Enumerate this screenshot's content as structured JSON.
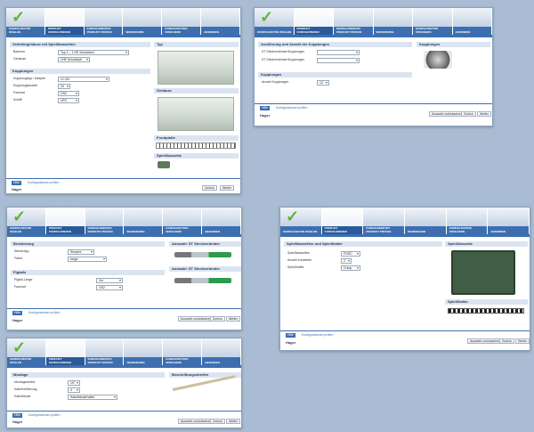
{
  "tabs": [
    {
      "label": "KONFIGURATOR WÄHLEN"
    },
    {
      "label": "PRODUKT KONFIGURIEREN"
    },
    {
      "label": "KONFIGURIERTES PRODUKT PRÜFEN"
    },
    {
      "label": "WARENKORB"
    },
    {
      "label": "KONFIGURATION SPEICHERN"
    },
    {
      "label": "ABSENDEN"
    }
  ],
  "shot1": {
    "section_main": "Verteilergehäuse mit Spleißkassetten",
    "row_bauform": "Bauform",
    "sel_bauform": "Typ 1 – 1 HE Schubfach",
    "row_gehaeuse": "Gehäuse",
    "sel_gehaeuse": "1HE Schubfach",
    "section_kupplungen": "Kupplungen",
    "row_kupplungstyp": "Kupplungstyp / Adapter",
    "sel_kupplungstyp": "LC-DX",
    "row_kupplungsanzahl": "Kupplungsanzahl",
    "sel_kupplungsanzahl": "24",
    "row_faserart1": "Faserart",
    "sel_faserart1": "OS2",
    "row_faserart2": "Schliff",
    "sel_faserart2": "UPC",
    "right_top": "Typ",
    "right_mid": "Gehäuse",
    "right_frontplatte": "Frontplatte",
    "right_spleiss": "Spleißkassette",
    "help": "Hilfe",
    "link": "Konfigurationen prüfen",
    "btn_back": "Zurück",
    "btn_next": "Weiter",
    "logo": "Hager"
  },
  "shot2": {
    "section_main": "Ausführung und Anzahl der Kupplungen",
    "row1": "ST Steckverbinder/Kupplungen",
    "row2": "ST Steckverbinder/Kupplungen",
    "section_kupplungen": "Kupplungen",
    "row3": "Anzahl Kupplungen",
    "sel3": "12",
    "right_title": "Kupplungen",
    "help": "Hilfe",
    "link": "Konfigurationen prüfen",
    "btn_reset": "Auswahl zurücksetzen",
    "btn_back": "Zurück",
    "btn_next": "Weiter",
    "logo": "Hager"
  },
  "shot3": {
    "section_main": "Bestückung",
    "row1": "Steckertyp",
    "sel1": "Simplex",
    "row2": "Farbe",
    "sel2": "beige",
    "section_pigtails": "Pigtails",
    "row3": "Pigtail-Länge",
    "sel3": "2m",
    "row4": "Faserart",
    "sel4": "OS2",
    "right_top": "Auswahl: ST Steckverbinder",
    "right_mid": "Auswahl: ST Steckverbinder",
    "help": "Hilfe",
    "link": "Konfigurationen prüfen",
    "btn_reset": "Auswahl zurücksetzen",
    "btn_back": "Zurück",
    "btn_next": "Weiter",
    "logo": "Hager"
  },
  "shot4": {
    "section_main": "Spleißkassetten und Spleißhalter",
    "row1": "Spleißkassetten",
    "sel1": "FOSC",
    "row2": "Anzahl Kassetten",
    "sel2": "2",
    "row3": "Spleißhalter",
    "sel3": "Crimp",
    "right_top": "Spleißkassette",
    "right_mid": "Spleißhalter",
    "help": "Hilfe",
    "link": "Konfigurationen prüfen",
    "btn_reset": "Auswahl zurücksetzen",
    "btn_back": "Zurück",
    "btn_next": "Weiter",
    "logo": "Hager"
  },
  "shot5": {
    "section_main": "Montage",
    "row1": "Montagewinkel",
    "sel1": "19\"",
    "row2": "Kabeleinführung",
    "sel2": "4",
    "row3": "Kabelbinder",
    "sel3": "Kabelbinderhalter",
    "right_top": "Beschriftungsstreifen",
    "help": "Hilfe",
    "link": "Konfigurationen prüfen",
    "btn_reset": "Auswahl zurücksetzen",
    "btn_back": "Zurück",
    "btn_next": "Weiter",
    "logo": "Hager"
  },
  "colors": {
    "accent": "#3d6fb0",
    "check": "#5fb233",
    "background": "#a9bcd3"
  }
}
